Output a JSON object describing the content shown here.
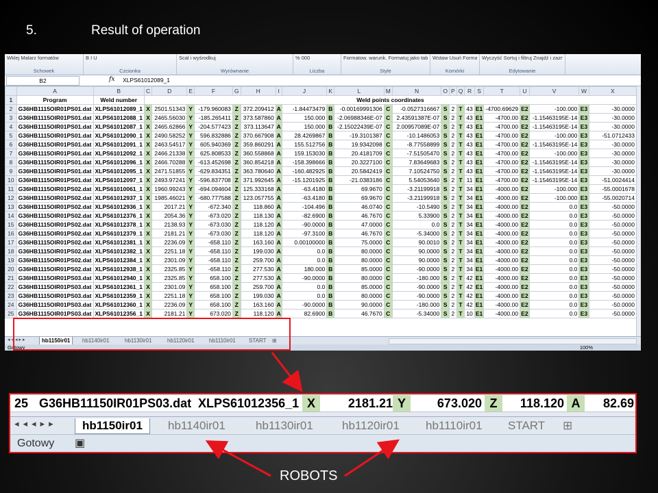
{
  "slide": {
    "number": "5.",
    "title": "Result of operation",
    "robots_label": "ROBOTS"
  },
  "ribbon": {
    "groups": [
      {
        "label": "Schowek",
        "content": "Wklej  Malarz formatów"
      },
      {
        "label": "Czcionka",
        "content": "B  I  U"
      },
      {
        "label": "Wyrównanie",
        "content": "Scal i wyśrodkuj"
      },
      {
        "label": "Liczba",
        "content": "%  000"
      },
      {
        "label": "Style",
        "content": "Formatow. warunk.  Formatuj jako tabelę  Style komórki"
      },
      {
        "label": "Komórki",
        "content": "Wstaw  Usuń  Format"
      },
      {
        "label": "Edytowanie",
        "content": "Wyczyść  Sortuj i filtruj  Znajdź i zaznacz"
      }
    ]
  },
  "formula_bar": {
    "cell": "B2",
    "fx": "fx",
    "value": "XLPS61012089_1"
  },
  "columns": [
    "A",
    "B",
    "C",
    "D",
    "E",
    "F",
    "G",
    "H",
    "I",
    "J",
    "K",
    "L",
    "M",
    "N",
    "O",
    "P",
    "Q",
    "R",
    "S",
    "T",
    "U",
    "V",
    "W",
    "X"
  ],
  "header_row": {
    "program": "Program",
    "weld_number": "Weld number",
    "coords": "Weld points coordinates"
  },
  "rows": [
    [
      "2",
      "G36HB1115OIR01PS01.dat",
      "XLPS61012089_1",
      "X",
      "2501.51343",
      "Y",
      "-179.960083",
      "Z",
      "372.209412",
      "A",
      "-1.84473479",
      "B",
      "-0.00169991306",
      "C",
      "-0.0527316667",
      "S",
      "2",
      "T",
      "43",
      "E1",
      "-4700.69629",
      "E2",
      "-100.000",
      "E3",
      "-30.0000"
    ],
    [
      "3",
      "G36HB1115OIR01PS01.dat",
      "XLPS61012088_1",
      "X",
      "2465.56030",
      "Y",
      "-185.265411",
      "Z",
      "373.587860",
      "A",
      "150.000",
      "B",
      "-2.06988346E-07",
      "C",
      "2.43591387E-07",
      "S",
      "2",
      "T",
      "43",
      "E1",
      "-4700.00",
      "E2",
      "-1.15463195E-14",
      "E3",
      "-30.0000"
    ],
    [
      "4",
      "G36HB1115OIR01PS01.dat",
      "XLPS61012087_1",
      "X",
      "2465.62866",
      "Y",
      "-204.577423",
      "Z",
      "373.113647",
      "A",
      "150.000",
      "B",
      "-2.15022439E-07",
      "C",
      "2.00957089E-07",
      "S",
      "2",
      "T",
      "43",
      "E1",
      "-4700.00",
      "E2",
      "-1.15463195E-14",
      "E3",
      "-30.0000"
    ],
    [
      "5",
      "G36HB1115OIR01PS01.dat",
      "XLPS61012090_1",
      "X",
      "2490.58252",
      "Y",
      "596.832886",
      "Z",
      "370.667908",
      "A",
      "28.4269867",
      "B",
      "-19.3101387",
      "C",
      "-10.1486053",
      "S",
      "2",
      "T",
      "43",
      "E1",
      "-4700.00",
      "E2",
      "-100.000",
      "E3",
      "-51.0712433"
    ],
    [
      "6",
      "G36HB1115OIR01PS01.dat",
      "XLPS61012091_1",
      "X",
      "2463.54517",
      "Y",
      "605.940369",
      "Z",
      "359.860291",
      "A",
      "155.512756",
      "B",
      "19.9342098",
      "C",
      "-8.77558899",
      "S",
      "2",
      "T",
      "43",
      "E1",
      "-4700.00",
      "E2",
      "-1.15463195E-14",
      "E3",
      "-30.0000"
    ],
    [
      "7",
      "G36HB1115OIR01PS01.dat",
      "XLPS61012092_1",
      "X",
      "2466.21338",
      "Y",
      "625.808533",
      "Z",
      "360.558868",
      "A",
      "159.153030",
      "B",
      "20.4181709",
      "C",
      "-7.51505470",
      "S",
      "2",
      "T",
      "43",
      "E1",
      "-4700.00",
      "E2",
      "-100.000",
      "E3",
      "-30.0000"
    ],
    [
      "8",
      "G36HB1115OIR01PS01.dat",
      "XLPS61012096_1",
      "X",
      "2466.70288",
      "Y",
      "-613.452698",
      "Z",
      "360.854218",
      "A",
      "-158.398666",
      "B",
      "20.3227100",
      "C",
      "7.83649683",
      "S",
      "2",
      "T",
      "43",
      "E1",
      "-4700.00",
      "E2",
      "-1.15463195E-14",
      "E3",
      "-30.0000"
    ],
    [
      "9",
      "G36HB1115OIR01PS01.dat",
      "XLPS61012095_1",
      "X",
      "2471.51855",
      "Y",
      "-629.834351",
      "Z",
      "363.780640",
      "A",
      "-160.482925",
      "B",
      "20.5842419",
      "C",
      "7.10524750",
      "S",
      "2",
      "T",
      "43",
      "E1",
      "-4700.00",
      "E2",
      "-1.15463195E-14",
      "E3",
      "-30.0000"
    ],
    [
      "10",
      "G36HB1115OIR01PS01.dat",
      "XLPS61012097_1",
      "X",
      "2493.97241",
      "Y",
      "-596.837708",
      "Z",
      "371.992645",
      "A",
      "-15.1201925",
      "B",
      "-21.0383186",
      "C",
      "5.54053640",
      "S",
      "2",
      "T",
      "11",
      "E1",
      "-4700.00",
      "E2",
      "-1.15463195E-14",
      "E3",
      "-51.0024414"
    ],
    [
      "11",
      "G36HB1115OIR01PS02.dat",
      "XLPS61010061_1",
      "X",
      "1960.99243",
      "Y",
      "-694.094604",
      "Z",
      "125.333168",
      "A",
      "-63.4180",
      "B",
      "69.9670",
      "C",
      "-3.21199918",
      "S",
      "2",
      "T",
      "34",
      "E1",
      "-4000.00",
      "E2",
      "-100.000",
      "E3",
      "-55.0001678"
    ],
    [
      "12",
      "G36HB1115OIR01PS02.dat",
      "XLPS61012937_1",
      "X",
      "1985.46021",
      "Y",
      "-680.777588",
      "Z",
      "123.057755",
      "A",
      "-63.4180",
      "B",
      "69.9670",
      "C",
      "-3.21199918",
      "S",
      "2",
      "T",
      "34",
      "E1",
      "-4000.00",
      "E2",
      "-100.000",
      "E3",
      "-55.0020714"
    ],
    [
      "13",
      "G36HB1115OIR01PS02.dat",
      "XLPS61012936_1",
      "X",
      "2017.21",
      "Y",
      "-672.340",
      "Z",
      "118.860",
      "A",
      "-104.496",
      "B",
      "46.0740",
      "C",
      "-10.5490",
      "S",
      "2",
      "T",
      "34",
      "E1",
      "-4000.00",
      "E2",
      "0.0",
      "E3",
      "-50.0000"
    ],
    [
      "14",
      "G36HB1115OIR01PS02.dat",
      "XLPS61012376_1",
      "X",
      "2054.36",
      "Y",
      "-673.020",
      "Z",
      "118.130",
      "A",
      "-82.6900",
      "B",
      "46.7670",
      "C",
      "5.33900",
      "S",
      "2",
      "T",
      "34",
      "E1",
      "-4000.00",
      "E2",
      "0.0",
      "E3",
      "-50.0000"
    ],
    [
      "15",
      "G36HB1115OIR01PS02.dat",
      "XLPS61012378_1",
      "X",
      "2138.93",
      "Y",
      "-673.030",
      "Z",
      "118.120",
      "A",
      "-90.0000",
      "B",
      "47.0000",
      "C",
      "0.0",
      "S",
      "2",
      "T",
      "34",
      "E1",
      "-4000.00",
      "E2",
      "0.0",
      "E3",
      "-50.0000"
    ],
    [
      "16",
      "G36HB1115OIR01PS02.dat",
      "XLPS61012379_1",
      "X",
      "2181.21",
      "Y",
      "-673.030",
      "Z",
      "118.120",
      "A",
      "-97.3100",
      "B",
      "46.7670",
      "C",
      "-5.34000",
      "S",
      "2",
      "T",
      "34",
      "E1",
      "-4000.00",
      "E2",
      "0.0",
      "E3",
      "-50.0000"
    ],
    [
      "17",
      "G36HB1115OIR01PS02.dat",
      "XLPS61012381_1",
      "X",
      "2236.09",
      "Y",
      "-658.110",
      "Z",
      "163.160",
      "A",
      "0.00100000",
      "B",
      "75.0000",
      "C",
      "90.0010",
      "S",
      "2",
      "T",
      "34",
      "E1",
      "-4000.00",
      "E2",
      "0.0",
      "E3",
      "-50.0000"
    ],
    [
      "18",
      "G36HB1115OIR01PS02.dat",
      "XLPS61012382_1",
      "X",
      "2251.18",
      "Y",
      "-658.110",
      "Z",
      "199.030",
      "A",
      "0.0",
      "B",
      "80.0000",
      "C",
      "90.0000",
      "S",
      "2",
      "T",
      "34",
      "E1",
      "-4000.00",
      "E2",
      "0.0",
      "E3",
      "-50.0000"
    ],
    [
      "19",
      "G36HB1115OIR01PS02.dat",
      "XLPS61012384_1",
      "X",
      "2301.09",
      "Y",
      "-658.110",
      "Z",
      "259.700",
      "A",
      "0.0",
      "B",
      "80.0000",
      "C",
      "90.0000",
      "S",
      "2",
      "T",
      "34",
      "E1",
      "-4000.00",
      "E2",
      "0.0",
      "E3",
      "-50.0000"
    ],
    [
      "20",
      "G36HB1115OIR01PS02.dat",
      "XLPS61012938_1",
      "X",
      "2325.85",
      "Y",
      "-658.110",
      "Z",
      "277.530",
      "A",
      "180.000",
      "B",
      "85.0000",
      "C",
      "-90.0000",
      "S",
      "2",
      "T",
      "34",
      "E1",
      "-4000.00",
      "E2",
      "0.0",
      "E3",
      "-50.0000"
    ],
    [
      "21",
      "G36HB1115OIR01PS03.dat",
      "XLPS61012940_1",
      "X",
      "2325.85",
      "Y",
      "658.100",
      "Z",
      "277.530",
      "A",
      "-90.0000",
      "B",
      "80.0000",
      "C",
      "-180.000",
      "S",
      "2",
      "T",
      "42",
      "E1",
      "-4000.00",
      "E2",
      "0.0",
      "E3",
      "-50.0000"
    ],
    [
      "22",
      "G36HB1115OIR01PS03.dat",
      "XLPS61012361_1",
      "X",
      "2301.09",
      "Y",
      "658.100",
      "Z",
      "259.700",
      "A",
      "0.0",
      "B",
      "85.0000",
      "C",
      "-90.0000",
      "S",
      "2",
      "T",
      "42",
      "E1",
      "-4000.00",
      "E2",
      "0.0",
      "E3",
      "-50.0000"
    ],
    [
      "23",
      "G36HB1115OIR01PS03.dat",
      "XLPS61012359_1",
      "X",
      "2251.18",
      "Y",
      "658.100",
      "Z",
      "199.030",
      "A",
      "0.0",
      "B",
      "80.0000",
      "C",
      "-90.0000",
      "S",
      "2",
      "T",
      "42",
      "E1",
      "-4000.00",
      "E2",
      "0.0",
      "E3",
      "-50.0000"
    ],
    [
      "24",
      "G36HB1115OIR01PS03.dat",
      "XLPS61012360_1",
      "X",
      "2236.09",
      "Y",
      "658.100",
      "Z",
      "163.160",
      "A",
      "-90.0000",
      "B",
      "90.0000",
      "C",
      "-180.000",
      "S",
      "2",
      "T",
      "42",
      "E1",
      "-4000.00",
      "E2",
      "0.0",
      "E3",
      "-50.0000"
    ],
    [
      "25",
      "G36HB1115OIR01PS03.dat",
      "XLPS61012356_1",
      "X",
      "2181.21",
      "Y",
      "673.020",
      "Z",
      "118.120",
      "A",
      "82.6900",
      "B",
      "46.7670",
      "C",
      "-5.34000",
      "S",
      "2",
      "T",
      "10",
      "E1",
      "-4000.00",
      "E2",
      "0.0",
      "E3",
      "-50.0000"
    ]
  ],
  "sheets": [
    "hb1150ir01",
    "hb1140ir01",
    "hb1130ir01",
    "hb1120ir01",
    "hb1110ir01",
    "START"
  ],
  "status": {
    "ready": "Gotowy",
    "zoom": "100%"
  },
  "zoom_view": {
    "row": [
      "25",
      "G36HB11150IR01PS03.dat",
      "XLPS61012356_1",
      "X",
      "2181.21",
      "Y",
      "673.020",
      "Z",
      "118.120",
      "A",
      "82.69"
    ]
  }
}
